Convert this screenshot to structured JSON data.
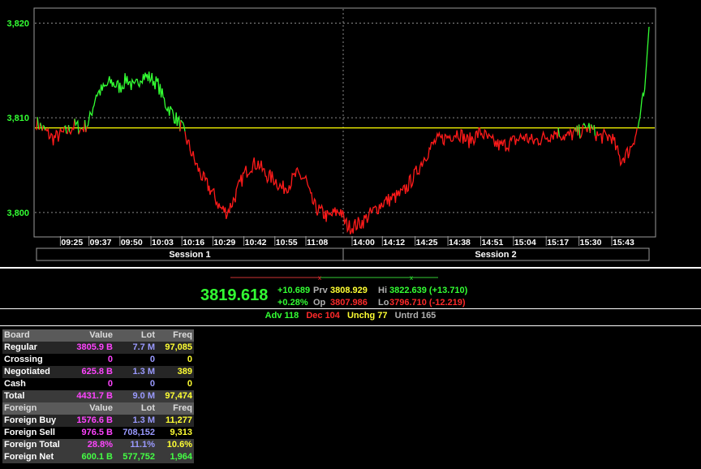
{
  "chart_data": {
    "type": "line",
    "title": "",
    "ylabel": "",
    "ylim": [
      3797.5,
      3821.5
    ],
    "y_ticks": [
      "3,800",
      "3,810",
      "3,820"
    ],
    "y_tick_values": [
      3800,
      3810,
      3820
    ],
    "x_tick_labels": [
      "09:25",
      "09:37",
      "09:50",
      "10:03",
      "10:16",
      "10:29",
      "10:42",
      "10:55",
      "11:08",
      "14:00",
      "14:12",
      "14:25",
      "14:38",
      "14:51",
      "15:04",
      "15:17",
      "15:30",
      "15:43"
    ],
    "reference_line": 3808.929,
    "sessions": [
      "Session 1",
      "Session 2"
    ],
    "colors": {
      "above": "#33ff33",
      "below": "#ff1a1a",
      "reference": "#ffff00",
      "grid": "#8a8a8a"
    },
    "series": [
      {
        "x": [
          "09:15",
          "09:19",
          "09:22",
          "09:25",
          "09:28",
          "09:31",
          "09:34",
          "09:37",
          "09:40",
          "09:43",
          "09:46",
          "09:50",
          "09:53",
          "09:56",
          "09:59",
          "10:03",
          "10:06",
          "10:09",
          "10:12",
          "10:16",
          "10:19",
          "10:22",
          "10:25",
          "10:29",
          "10:32",
          "10:35",
          "10:38",
          "10:42",
          "10:45",
          "10:48",
          "10:51",
          "10:55",
          "10:58",
          "11:01",
          "11:04",
          "11:08",
          "11:11",
          "11:14",
          "11:18",
          "11:22",
          "11:27",
          "13:30",
          "13:40",
          "13:50",
          "14:00",
          "14:04",
          "14:08",
          "14:12",
          "14:16",
          "14:20",
          "14:25",
          "14:29",
          "14:33",
          "14:38",
          "14:42",
          "14:46",
          "14:51",
          "14:55",
          "14:59",
          "15:04",
          "15:08",
          "15:12",
          "15:17",
          "15:21",
          "15:25",
          "15:30",
          "15:34",
          "15:38",
          "15:43",
          "15:47",
          "15:51",
          "15:55",
          "15:58",
          "16:00"
        ],
        "values": [
          3809.5,
          3808.5,
          3807.8,
          3808.2,
          3808.6,
          3809.2,
          3808.8,
          3809.5,
          3812.5,
          3813.0,
          3813.8,
          3813.2,
          3814.2,
          3813.0,
          3814.5,
          3814.2,
          3813.5,
          3811.5,
          3810.5,
          3809.0,
          3807.0,
          3805.0,
          3803.5,
          3802.0,
          3800.5,
          3800.0,
          3801.5,
          3804.0,
          3805.0,
          3805.2,
          3804.0,
          3803.5,
          3802.5,
          3803.0,
          3804.0,
          3803.5,
          3801.5,
          3800.5,
          3800.0,
          3799.5,
          3800.0,
          3800.2,
          3799.0,
          3798.5,
          3798.5,
          3799.0,
          3800.0,
          3801.0,
          3801.5,
          3802.0,
          3804.0,
          3806.0,
          3807.5,
          3808.0,
          3808.5,
          3807.5,
          3808.5,
          3807.5,
          3807.0,
          3807.5,
          3808.0,
          3807.5,
          3808.0,
          3808.5,
          3808.0,
          3808.5,
          3809.0,
          3808.0,
          3808.0,
          3805.5,
          3806.5,
          3809.0,
          3813.0,
          3819.618
        ]
      }
    ]
  },
  "quote": {
    "last": "3819.618",
    "change": "+10.689",
    "change_pct": "+0.28%",
    "prv_label": "Prv",
    "prv_value": "3808.929",
    "op_label": "Op",
    "op_value": "3807.986",
    "hi_label": "Hi",
    "hi_value": "3822.639 (+13.710)",
    "lo_label": "Lo",
    "lo_value": "3796.710 (-12.219)"
  },
  "breadth": {
    "adv": "Adv 118",
    "dec": "Dec 104",
    "unchg": "Unchg 77",
    "untrd": "Untrd 165"
  },
  "board_table": {
    "headers": [
      "Board",
      "Value",
      "Lot",
      "Freq"
    ],
    "rows": [
      [
        "Regular",
        "3805.9 B",
        "7.7 M",
        "97,085"
      ],
      [
        "Crossing",
        "0",
        "0",
        "0"
      ],
      [
        "Negotiated",
        "625.8 B",
        "1.3 M",
        "389"
      ],
      [
        "Cash",
        "0",
        "0",
        "0"
      ]
    ],
    "total": [
      "Total",
      "4431.7 B",
      "9.0 M",
      "97,474"
    ]
  },
  "foreign_table": {
    "headers": [
      "Foreign",
      "Value",
      "Lot",
      "Freq"
    ],
    "rows": [
      [
        "Foreign Buy",
        "1576.6 B",
        "1.3 M",
        "11,277"
      ],
      [
        "Foreign Sell",
        "976.5 B",
        "708,152",
        "9,313"
      ],
      [
        "Foreign Total",
        "28.8%",
        "11.1%",
        "10.6%"
      ],
      [
        "Foreign Net",
        "600.1 B",
        "577,752",
        "1,964"
      ]
    ]
  }
}
